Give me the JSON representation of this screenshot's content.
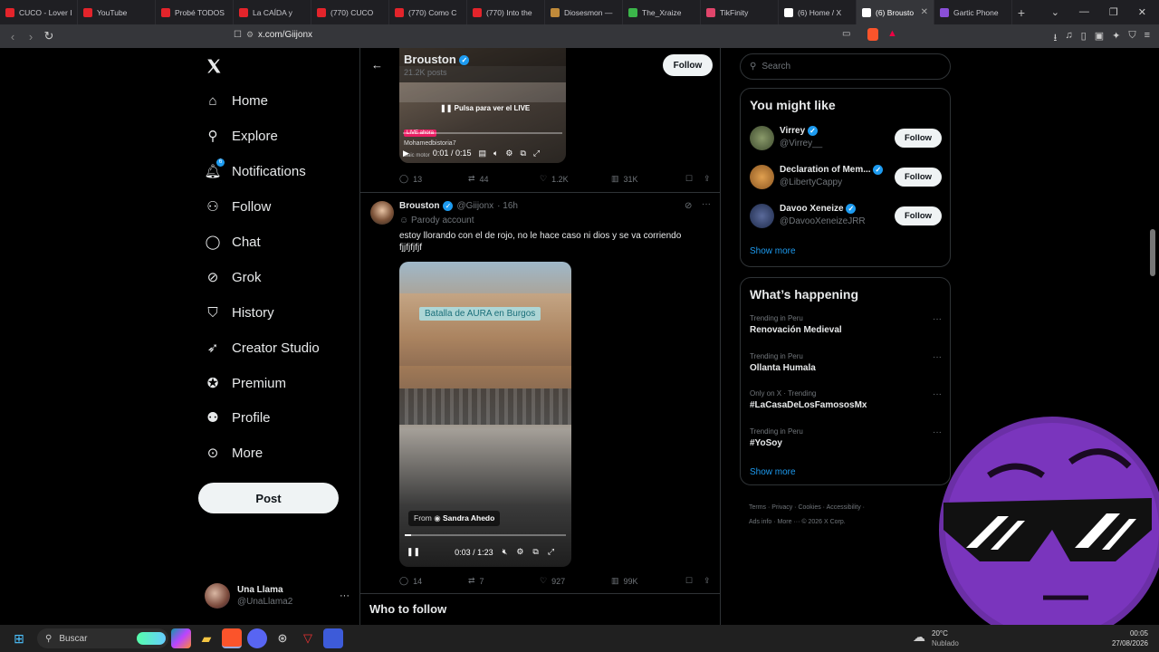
{
  "browser": {
    "tabs": [
      {
        "label": "CUCO - Lover I",
        "color": "#e3242b"
      },
      {
        "label": "YouTube",
        "color": "#e3242b"
      },
      {
        "label": "Probé TODOS",
        "color": "#e3242b"
      },
      {
        "label": "La CAÍDA y",
        "color": "#e3242b"
      },
      {
        "label": "(770) CUCO",
        "color": "#e3242b"
      },
      {
        "label": "(770) Como C",
        "color": "#e3242b"
      },
      {
        "label": "(770) Into the",
        "color": "#e3242b"
      },
      {
        "label": "Diosesmon —",
        "color": "#c08a3a"
      },
      {
        "label": "The_Xraize",
        "color": "#3bb54a"
      },
      {
        "label": "TikFinity",
        "color": "#e0456b"
      },
      {
        "label": "(6) Home / X",
        "color": "#ffffff"
      },
      {
        "label": "(6) Brousto",
        "color": "#ffffff"
      },
      {
        "label": "Gartic Phone",
        "color": "#8a4fd8"
      }
    ],
    "url": "x.com/Giijonx"
  },
  "nav": {
    "items": [
      {
        "label": "Home",
        "icon": "home-icon"
      },
      {
        "label": "Explore",
        "icon": "search-icon"
      },
      {
        "label": "Notifications",
        "icon": "bell-icon"
      },
      {
        "label": "Follow",
        "icon": "add-user-icon"
      },
      {
        "label": "Chat",
        "icon": "chat-icon"
      },
      {
        "label": "Grok",
        "icon": "grok-icon"
      },
      {
        "label": "History",
        "icon": "bookmark-icon"
      },
      {
        "label": "Creator Studio",
        "icon": "rocket-icon"
      },
      {
        "label": "Premium",
        "icon": "verified-icon"
      },
      {
        "label": "Profile",
        "icon": "person-icon"
      },
      {
        "label": "More",
        "icon": "more-circle-icon"
      }
    ],
    "notif_badge": "6",
    "post_label": "Post",
    "account_name": "Una Llama",
    "account_handle": "@UnaLlama2"
  },
  "header": {
    "name": "Brouston",
    "posts": "21.2K posts",
    "follow_label": "Follow"
  },
  "tweet1": {
    "video_caption": "Pulsa para ver el LIVE",
    "live_badge": "LIVE ahora",
    "overlay_name": "Mohamedbistoria7",
    "overlay_sub": "Saic motor",
    "time": "0:01 / 0:15",
    "replies": "13",
    "reposts": "44",
    "likes": "1.2K",
    "views": "31K"
  },
  "tweet2": {
    "name": "Brouston",
    "handle": "@Giijonx",
    "age": "· 16h",
    "parody": "Parody account",
    "text_line1": "estoy llorando con el de rojo, no le hace caso ni dios y se va corriendo",
    "text_line2": "fjjfjfjfjf",
    "video_caption": "Batalla de AURA en Burgos",
    "from_label": "From",
    "from_name": "Sandra Ahedo",
    "time": "0:03 / 1:23",
    "progress": 0.04,
    "replies": "14",
    "reposts": "7",
    "likes": "927",
    "views": "99K"
  },
  "who_to_follow": "Who to follow",
  "right": {
    "search_placeholder": "Search",
    "you_might_like": "You might like",
    "suggestions": [
      {
        "name": "Virrey",
        "handle": "@Virrey__",
        "follow": "Follow"
      },
      {
        "name": "Declaration of Mem...",
        "handle": "@LibertyCappy",
        "follow": "Follow"
      },
      {
        "name": "Davoo Xeneize",
        "handle": "@DavooXeneizeJRR",
        "follow": "Follow"
      }
    ],
    "show_more": "Show more",
    "whats_happening": "What’s happening",
    "trends": [
      {
        "context": "Trending in Peru",
        "title": "Renovación Medieval"
      },
      {
        "context": "Trending in Peru",
        "title": "Ollanta Humala"
      },
      {
        "context": "Only on X · Trending",
        "title": "#LaCasaDeLosFamososMx"
      },
      {
        "context": "Trending in Peru",
        "title": "#YoSoy"
      }
    ],
    "show_more2": "Show more",
    "footer_line1": "Terms · Privacy · Cookies · Accessibility ·",
    "footer_line2": "Ads info · More ··· © 2026 X Corp."
  },
  "taskbar": {
    "search_label": "Buscar",
    "weather_temp": "20°C",
    "weather_desc": "Nublado",
    "time": "00:05",
    "date": "27/08/2026"
  },
  "colors": {
    "accent": "#1d9bf0",
    "bg": "#000000",
    "border": "#2f3336",
    "muted": "#71767b"
  }
}
